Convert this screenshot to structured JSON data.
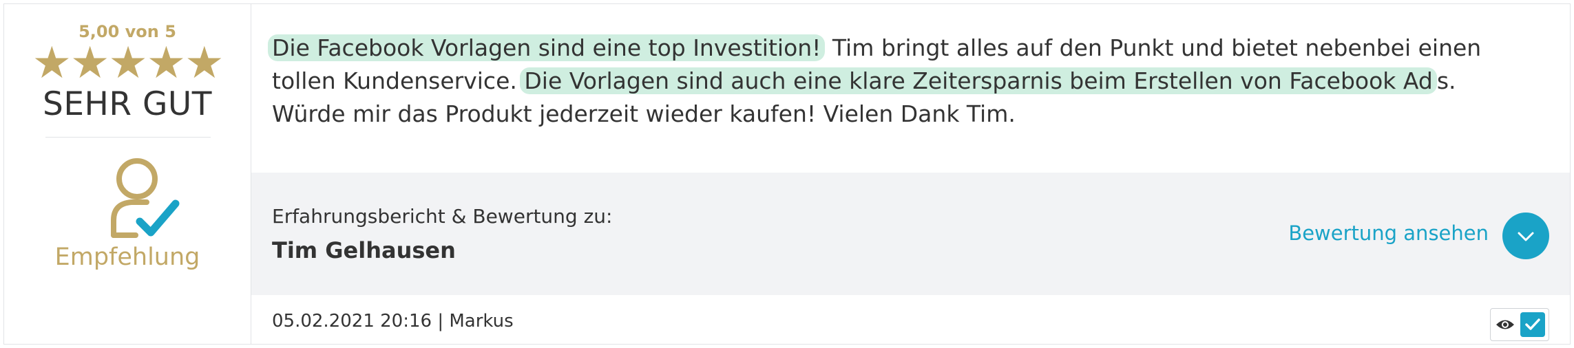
{
  "rating": {
    "score_text": "5,00 von 5",
    "stars": "★★★★★",
    "star_count": 5,
    "verdict": "SEHR GUT",
    "recommendation_label": "Empfehlung"
  },
  "review": {
    "segments": [
      {
        "text": "Die Facebook Vorlagen sind eine top Investition!",
        "highlight": true
      },
      {
        "text": " Tim bringt alles auf den Punkt und bietet nebenbei einen tollen Kundenservice. ",
        "highlight": false
      },
      {
        "text": "Die Vorlagen sind auch eine klare Zeitersparnis beim Erstellen von Facebook Ad",
        "highlight": true
      },
      {
        "text": "s. Würde mir das Produkt jederzeit wieder kaufen! Vielen Dank Tim.",
        "highlight": false
      }
    ]
  },
  "subject": {
    "label": "Erfahrungsbericht & Bewertung zu:",
    "name": "Tim Gelhausen",
    "view_link": "Bewertung ansehen"
  },
  "meta": {
    "date_author": "05.02.2021 20:16 | Markus"
  },
  "colors": {
    "gold": "#c2a866",
    "accent": "#1aa3c7",
    "highlight": "#cfeee0",
    "panel_gray": "#f2f3f5"
  }
}
